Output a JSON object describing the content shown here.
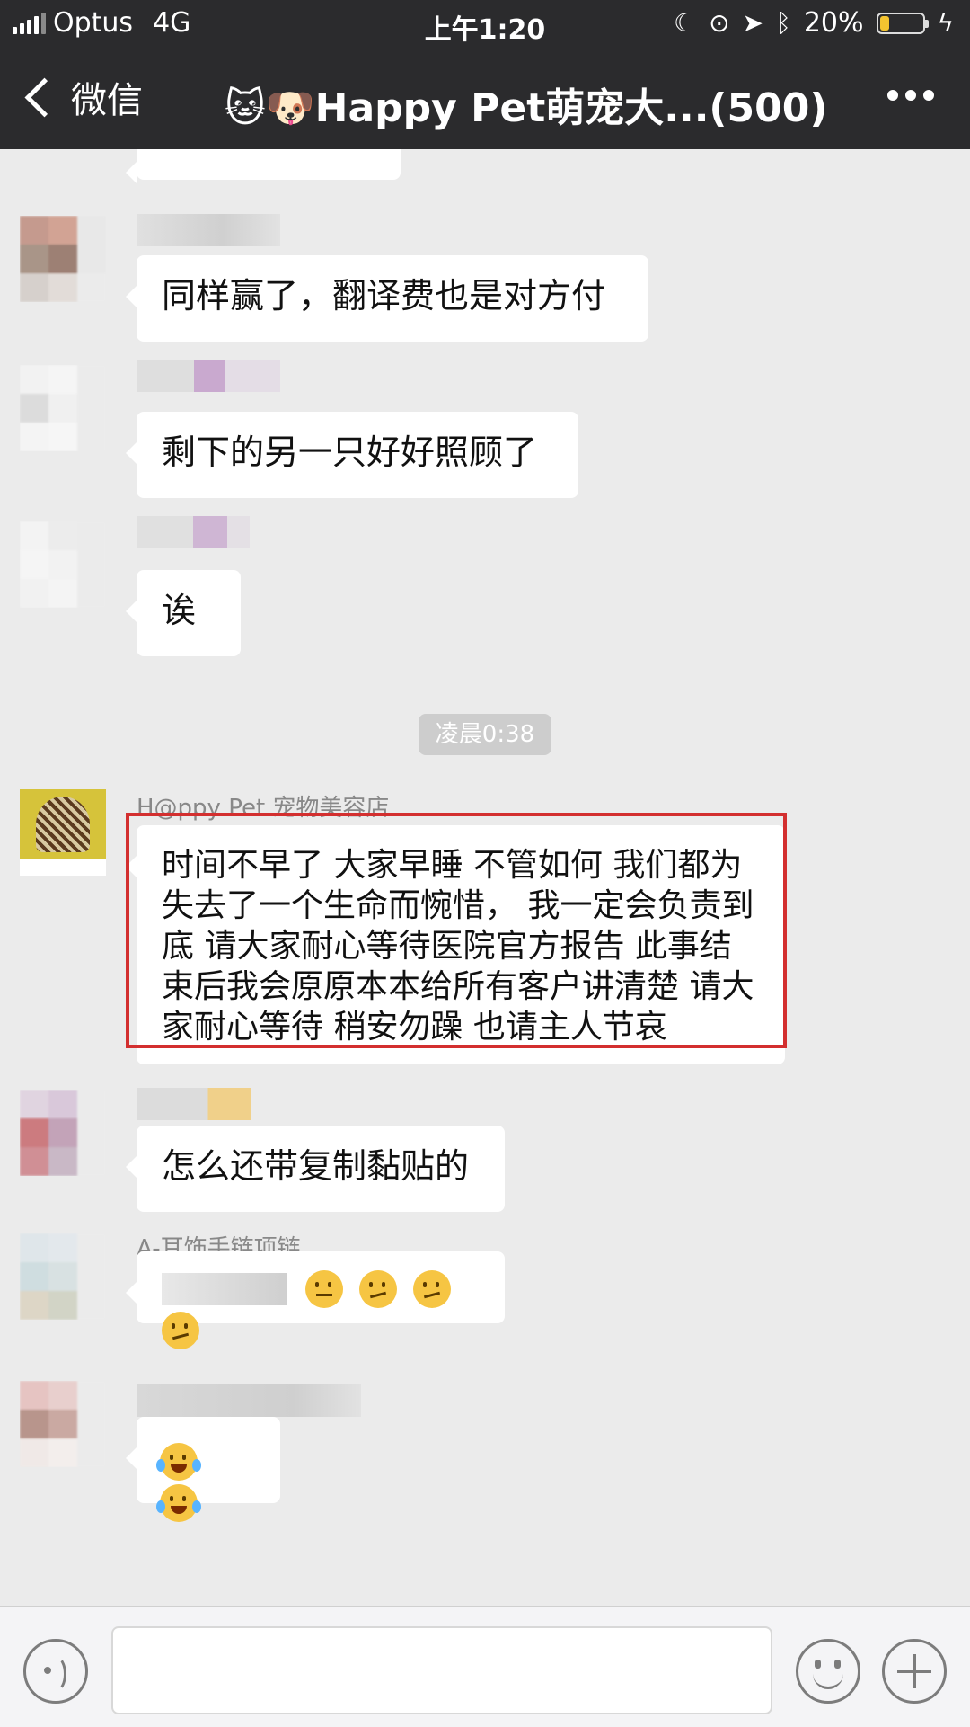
{
  "status_bar": {
    "carrier": "Optus",
    "network": "4G",
    "time": "上午1:20",
    "battery": "20%",
    "battery_level": 0.2
  },
  "nav": {
    "back_label": "微信",
    "title": "🐱🐶Happy Pet萌宠大...(500)"
  },
  "messages": {
    "m1": "同样赢了，翻译费也是对方付",
    "m2": "剩下的另一只好好照顾了",
    "m3": "诶",
    "timestamp": "凌晨0:38",
    "m4_sender": "H@ppy Pet 宠物美容店",
    "m4": "时间不早了 大家早睡 不管如何 我们都为失去了一个生命而惋惜， 我一定会负责到底 请大家耐心等待医院官方报告 此事结束后我会原原本本给所有客户讲清楚 请大家耐心等待 稍安勿躁 也请主人节哀",
    "m5": "怎么还带复制黏贴的",
    "m6_sender": "A-耳饰手链项链",
    "m6_emojis": [
      "neutral-face",
      "thinking-face",
      "thinking-face",
      "thinking-face"
    ],
    "m7_emojis": [
      "tears-of-joy",
      "tears-of-joy"
    ]
  },
  "colors": {
    "header_bg": "#2b2b2d",
    "chat_bg": "#ebebeb",
    "bubble_bg": "#ffffff",
    "highlight": "#d32f2f"
  }
}
